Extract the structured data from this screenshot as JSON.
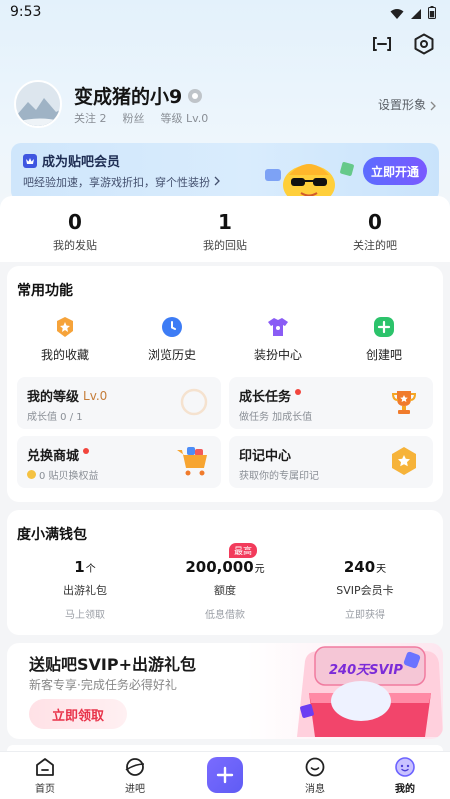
{
  "status_bar": {
    "time": "9:53"
  },
  "profile": {
    "name": "变成猪的小9",
    "following": "关注 2",
    "fans": "粉丝",
    "level": "等级 Lv.0",
    "set_image": "设置形象"
  },
  "vip_banner": {
    "title": "成为贴吧会员",
    "subtitle": "吧经验加速，享游戏折扣，穿个性装扮",
    "button": "立即开通"
  },
  "counts": [
    {
      "value": "0",
      "label": "我的发贴"
    },
    {
      "value": "1",
      "label": "我的回贴"
    },
    {
      "value": "0",
      "label": "关注的吧"
    }
  ],
  "common_functions": {
    "title": "常用功能",
    "items": [
      {
        "label": "我的收藏",
        "icon": "star-icon",
        "color": "#f59a23"
      },
      {
        "label": "浏览历史",
        "icon": "clock-icon",
        "color": "#3d7cf5"
      },
      {
        "label": "装扮中心",
        "icon": "shirt-icon",
        "color": "#8a5cf5"
      },
      {
        "label": "创建吧",
        "icon": "plus-icon",
        "color": "#2cc36b"
      }
    ],
    "tiles": [
      {
        "title": "我的等级",
        "extra": "Lv.0",
        "sub": "成长值 0 / 1",
        "icon": "progress-ring-icon"
      },
      {
        "title": "成长任务",
        "sub": "做任务 加成长值",
        "icon": "trophy-icon"
      },
      {
        "title": "兑换商城",
        "sub": "0 贴贝换权益",
        "icon": "shopping-cart-icon"
      },
      {
        "title": "印记中心",
        "sub": "获取你的专属印记",
        "icon": "medal-icon"
      }
    ]
  },
  "wallet": {
    "title": "度小满钱包",
    "hot_badge": "最高",
    "items": [
      {
        "value": "1",
        "unit": "个",
        "label": "出游礼包",
        "sub": "马上领取"
      },
      {
        "value": "200,000",
        "unit": "元",
        "label": "额度",
        "sub": "低息借款"
      },
      {
        "value": "240",
        "unit": "天",
        "label": "SVIP会员卡",
        "sub": "立即获得"
      }
    ]
  },
  "promo": {
    "title": "送贴吧SVIP+出游礼包",
    "subtitle": "新客专享·完成任务必得好礼",
    "button": "立即领取",
    "art_text": "240天SVIP"
  },
  "nav": {
    "items": [
      {
        "label": "首页"
      },
      {
        "label": "进吧"
      },
      {
        "label": "消息"
      },
      {
        "label": "我的"
      }
    ]
  },
  "colors": {
    "accent": "#6c63ff",
    "promo_red": "#e8334a",
    "vip_blue": "#5c6cff"
  }
}
